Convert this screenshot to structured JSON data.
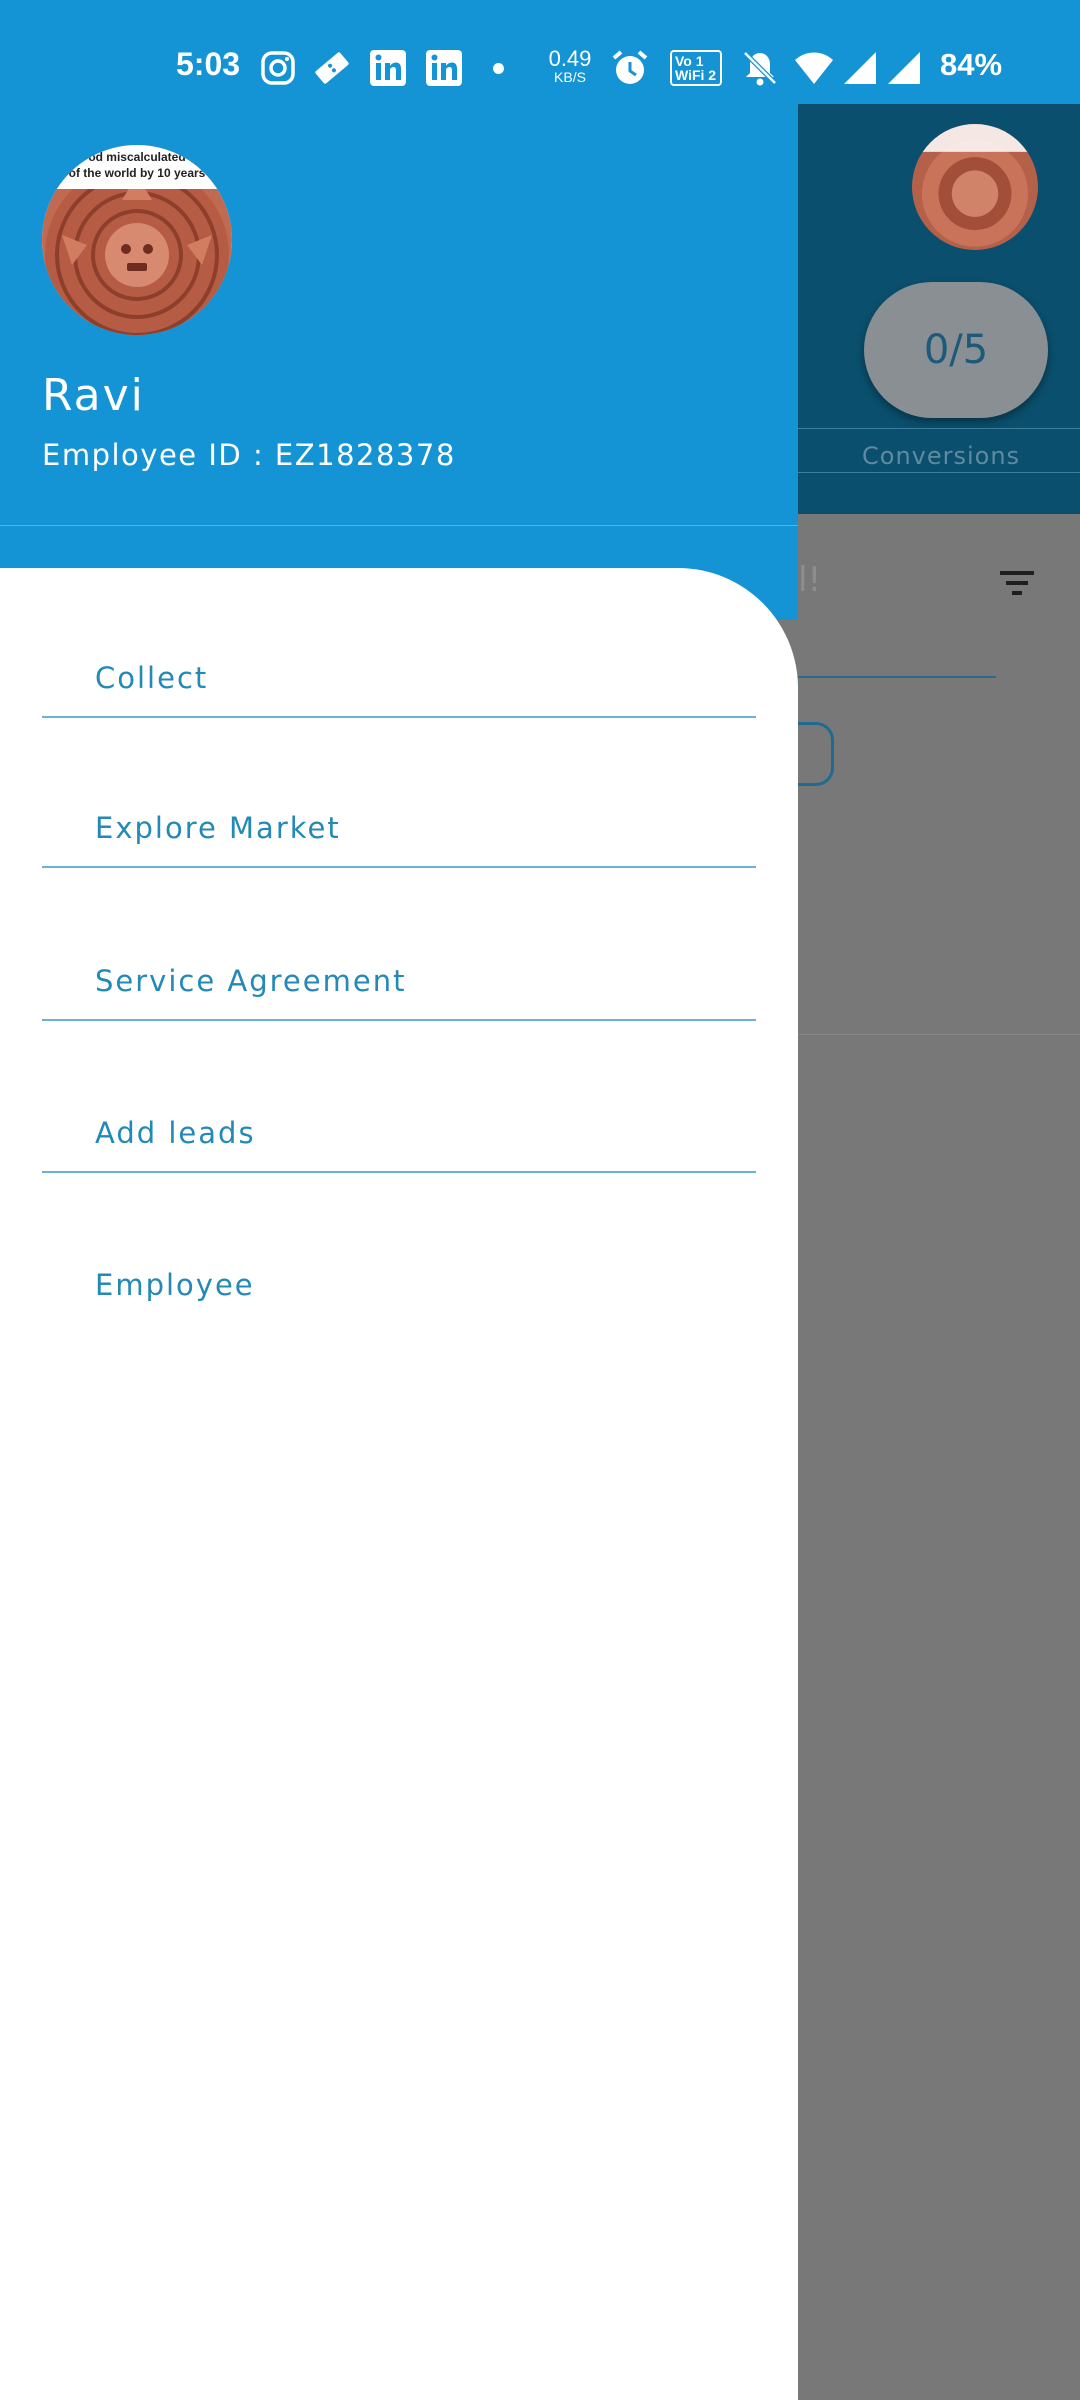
{
  "status_bar": {
    "time": "5:03",
    "notification_icons": [
      "instagram-icon",
      "ticket-icon",
      "linkedin-icon",
      "linkedin-icon",
      "dot-icon"
    ],
    "network_speed_value": "0.49",
    "network_speed_unit": "KB/S",
    "vowifi_line1": "Vo 1",
    "vowifi_line2": "WiFi 2",
    "battery": "84%",
    "colors": {
      "background": "#1493d5",
      "foreground": "#ffffff"
    }
  },
  "background_screen": {
    "counter_pill": "0/5",
    "conversions_label": "Conversions",
    "partial_text": "l!"
  },
  "drawer": {
    "user": {
      "name": "Ravi",
      "employee_id": "Employee ID : EZ1828378"
    },
    "avatar_caption_line1": "od miscalculated",
    "avatar_caption_line2": "of the world by 10 years",
    "menu_items": [
      {
        "label": "Collect"
      },
      {
        "label": "Explore Market"
      },
      {
        "label": "Service Agreement"
      },
      {
        "label": "Add leads"
      },
      {
        "label": "Employee"
      }
    ],
    "colors": {
      "header": "#1493d5",
      "menu_text": "#2389b6",
      "divider": "#6cb3d3",
      "scrim": "#787878"
    }
  }
}
